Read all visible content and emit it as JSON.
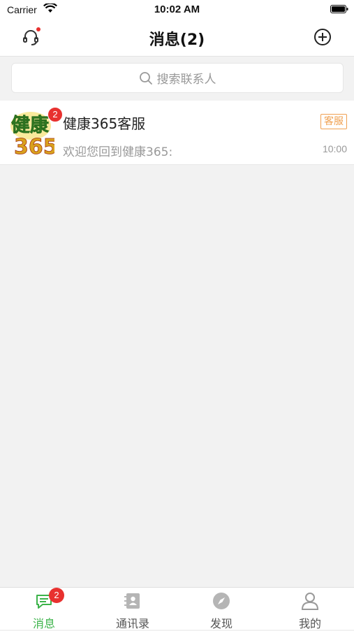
{
  "status_bar": {
    "carrier": "Carrier",
    "time": "10:02 AM"
  },
  "nav": {
    "title": "消息(2)"
  },
  "search": {
    "placeholder": "搜索联系人"
  },
  "conversations": [
    {
      "name": "健康365客服",
      "tag": "客服",
      "message": "欢迎您回到健康365:",
      "time": "10:00",
      "unread": "2",
      "avatar_text_top": "健康",
      "avatar_text_bottom": "365"
    }
  ],
  "tabs": [
    {
      "label": "消息",
      "icon": "message-icon",
      "badge": "2",
      "active": true
    },
    {
      "label": "通讯录",
      "icon": "contacts-icon",
      "active": false
    },
    {
      "label": "发现",
      "icon": "compass-icon",
      "active": false
    },
    {
      "label": "我的",
      "icon": "user-icon",
      "active": false
    }
  ],
  "colors": {
    "accent": "#3cb34a",
    "badge": "#e8312f",
    "tag": "#f0a050"
  }
}
